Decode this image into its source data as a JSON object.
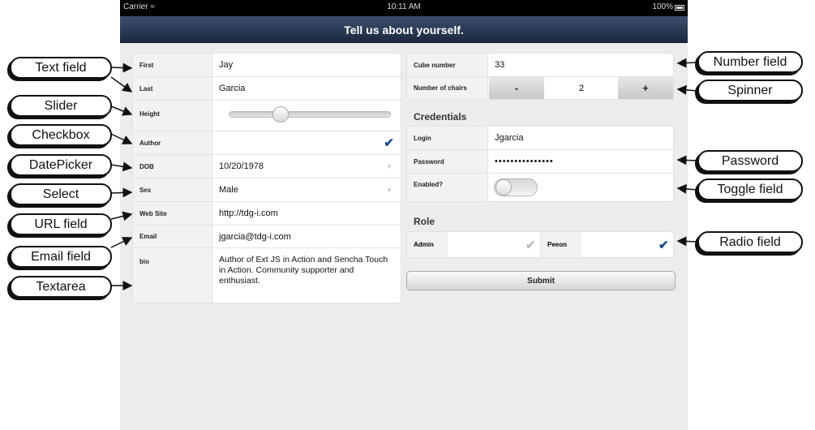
{
  "status_bar": {
    "carrier": "Carrier",
    "time": "10:11 AM",
    "battery": "100%"
  },
  "nav": {
    "title": "Tell us about yourself."
  },
  "left_form": {
    "first_label": "First",
    "first_value": "Jay",
    "last_label": "Last",
    "last_value": "Garcia",
    "height_label": "Height",
    "height_level": 0.3,
    "author_label": "Author",
    "author_checked": true,
    "dob_label": "DOB",
    "dob_value": "10/20/1978",
    "sex_label": "Sex",
    "sex_value": "Male",
    "website_label": "Web Site",
    "website_value": "http://tdg-i.com",
    "email_label": "Email",
    "email_value": "jgarcia@tdg-i.com",
    "bio_label": "bio",
    "bio_value": "Author of Ext JS in Action and Sencha Touch in Action.  Community supporter and enthusiast."
  },
  "right_form": {
    "cube_label": "Cube number",
    "cube_value": "33",
    "chairs_label": "Number of chairs",
    "chairs_minus": "-",
    "chairs_value": "2",
    "chairs_plus": "+",
    "credentials_title": "Credentials",
    "login_label": "Login",
    "login_value": "Jgarcia",
    "password_label": "Password",
    "password_value": "•••••••••••••••",
    "enabled_label": "Enabled?",
    "enabled_on": false,
    "role_title": "Role",
    "admin_label": "Admin",
    "admin_selected": false,
    "peeon_label": "Peeon",
    "peeon_selected": true,
    "submit_label": "Submit"
  },
  "callouts": {
    "text_field": "Text field",
    "slider": "Slider",
    "checkbox": "Checkbox",
    "datepicker": "DatePicker",
    "select": "Select",
    "url_field": "URL field",
    "email_field": "Email field",
    "textarea": "Textarea",
    "number_field": "Number field",
    "spinner": "Spinner",
    "password": "Password",
    "toggle_field": "Toggle field",
    "radio_field": "Radio field"
  },
  "colors": {
    "nav_bar": "#1b2840",
    "check": "#1c4a8c",
    "background": "#ececec"
  },
  "icons": [
    "wifi-icon",
    "battery-icon",
    "checkmark-icon",
    "dropdown-arrow-icon"
  ]
}
